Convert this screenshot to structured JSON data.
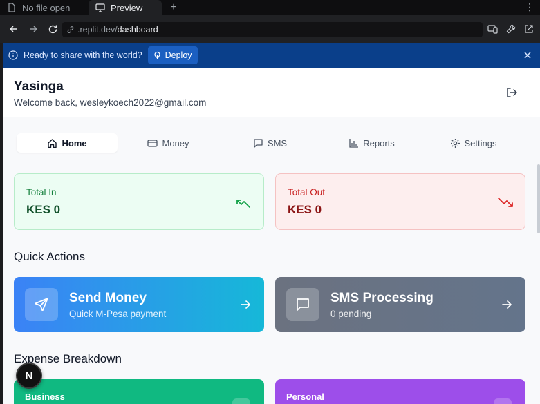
{
  "browser": {
    "tabs": [
      {
        "label": "No file open"
      },
      {
        "label": "Preview"
      }
    ],
    "new_tab_label": "+",
    "menu_label": "⋮",
    "url_host": ".replit.dev/",
    "url_path": "dashboard"
  },
  "deploy_banner": {
    "message": "Ready to share with the world?",
    "button_label": "Deploy"
  },
  "app": {
    "title": "Yasinga",
    "subtitle": "Welcome back, wesleykoech2022@gmail.com"
  },
  "nav": {
    "tabs": [
      {
        "label": "Home",
        "icon": "home-icon",
        "active": true
      },
      {
        "label": "Money",
        "icon": "credit-card-icon",
        "active": false
      },
      {
        "label": "SMS",
        "icon": "message-icon",
        "active": false
      },
      {
        "label": "Reports",
        "icon": "bar-chart-icon",
        "active": false
      },
      {
        "label": "Settings",
        "icon": "gear-icon",
        "active": false
      }
    ]
  },
  "stats": {
    "total_in": {
      "label": "Total In",
      "value": "KES 0",
      "color": "#15803d"
    },
    "total_out": {
      "label": "Total Out",
      "value": "KES 0",
      "color": "#c81e1e"
    }
  },
  "quick_actions": {
    "title": "Quick Actions",
    "send_money": {
      "title": "Send Money",
      "subtitle": "Quick M-Pesa payment"
    },
    "sms_processing": {
      "title": "SMS Processing",
      "subtitle": "0 pending"
    }
  },
  "expense_breakdown": {
    "title": "Expense Breakdown",
    "categories": [
      {
        "label": "Business",
        "color": "#10b981"
      },
      {
        "label": "Personal",
        "color": "#9d4eea"
      }
    ]
  },
  "dev_badge": {
    "label": "N"
  }
}
